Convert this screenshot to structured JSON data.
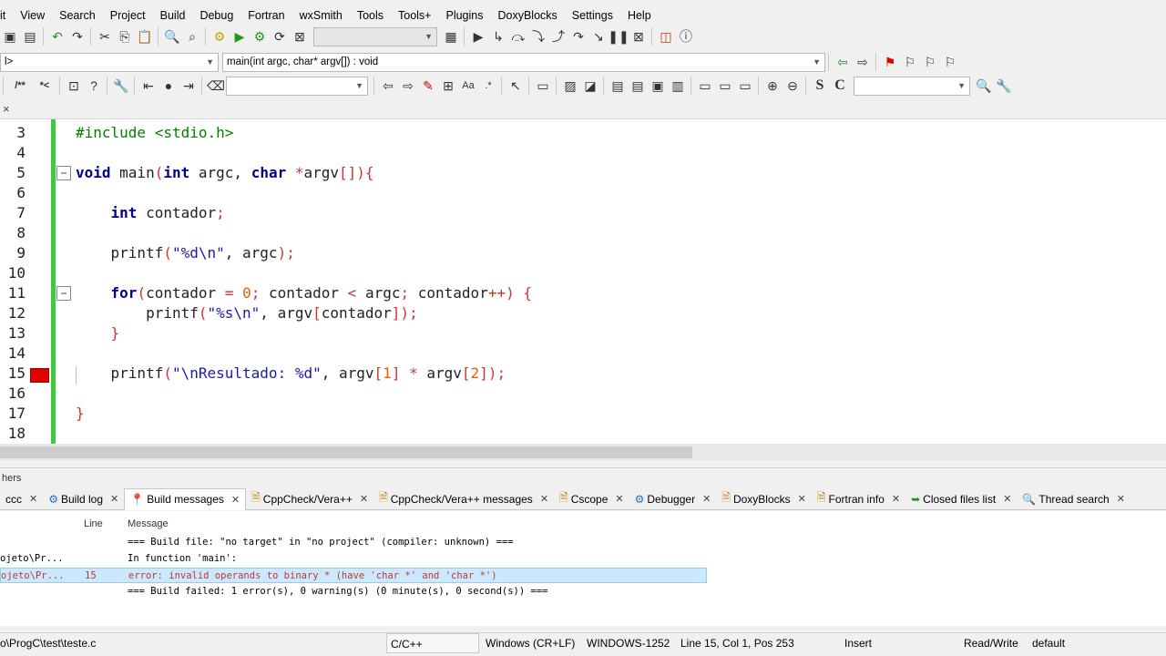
{
  "menu": [
    "it",
    "View",
    "Search",
    "Project",
    "Build",
    "Debug",
    "Fortran",
    "wxSmith",
    "Tools",
    "Tools+",
    "Plugins",
    "DoxyBlocks",
    "Settings",
    "Help"
  ],
  "toolbar2": {
    "scope_combo": "l>",
    "function_combo": "main(int argc, char* argv[]) : void"
  },
  "editor": {
    "close_glyph": "×",
    "lines": [
      {
        "n": "3",
        "html": "<span class=\"pp\">#include &lt;stdio.h&gt;</span>"
      },
      {
        "n": "4",
        "html": ""
      },
      {
        "n": "5",
        "html": "<span class=\"kw\">void</span> main<span class=\"op\">(</span><span class=\"kw\">int</span> argc, <span class=\"kw\">char</span> <span class=\"op\">*</span>argv<span class=\"op\">[]){</span>"
      },
      {
        "n": "6",
        "html": ""
      },
      {
        "n": "7",
        "html": "    <span class=\"kw\">int</span> contador<span class=\"op\">;</span>"
      },
      {
        "n": "8",
        "html": ""
      },
      {
        "n": "9",
        "html": "    printf<span class=\"op\">(</span><span class=\"str\">\"%d\\n\"</span>, argc<span class=\"op\">);</span>"
      },
      {
        "n": "10",
        "html": ""
      },
      {
        "n": "11",
        "html": "    <span class=\"kw\">for</span><span class=\"op\">(</span>contador <span class=\"op\">=</span> <span class=\"num\">0</span><span class=\"op\">;</span> contador <span class=\"op\">&lt;</span> argc<span class=\"op\">;</span> contador<span class=\"op\">++)</span> <span class=\"op\">{</span>"
      },
      {
        "n": "12",
        "html": "        printf<span class=\"op\">(</span><span class=\"str\">\"%s\\n\"</span>, argv<span class=\"op\">[</span>contador<span class=\"op\">]);</span>"
      },
      {
        "n": "13",
        "html": "    <span class=\"op\">}</span>"
      },
      {
        "n": "14",
        "html": ""
      },
      {
        "n": "15",
        "html": "    printf<span class=\"op\">(</span><span class=\"str\">\"\\nResultado: %d\"</span>, argv<span class=\"op\">[</span><span class=\"num\">1</span><span class=\"op\">]</span> <span class=\"op\">*</span> argv<span class=\"op\">[</span><span class=\"num\">2</span><span class=\"op\">]);</span>"
      },
      {
        "n": "16",
        "html": ""
      },
      {
        "n": "17",
        "html": "<span class=\"op\">}</span>"
      },
      {
        "n": "18",
        "html": ""
      }
    ]
  },
  "logs_title": "hers",
  "tabs": [
    {
      "label": "ccc",
      "icon": "",
      "active": false
    },
    {
      "label": "Build log",
      "icon": "gear-icon",
      "active": false
    },
    {
      "label": "Build messages",
      "icon": "pin-icon",
      "active": true
    },
    {
      "label": "CppCheck/Vera++",
      "icon": "doc-icon",
      "active": false
    },
    {
      "label": "CppCheck/Vera++ messages",
      "icon": "doc-icon",
      "active": false
    },
    {
      "label": "Cscope",
      "icon": "doc-icon",
      "active": false
    },
    {
      "label": "Debugger",
      "icon": "gear-icon",
      "active": false
    },
    {
      "label": "DoxyBlocks",
      "icon": "doc-icon",
      "active": false
    },
    {
      "label": "Fortran info",
      "icon": "doc-icon",
      "active": false
    },
    {
      "label": "Closed files list",
      "icon": "arrow-icon",
      "active": false
    },
    {
      "label": "Thread search",
      "icon": "search-icon",
      "active": false
    }
  ],
  "build_messages": {
    "col_line": "Line",
    "col_message": "Message",
    "rows": [
      {
        "file": "",
        "line": "",
        "message": "=== Build file: \"no target\" in \"no project\" (compiler: unknown) ===",
        "error": false
      },
      {
        "file": "ojeto\\Pr...",
        "line": "",
        "message": "In function 'main':",
        "error": false
      },
      {
        "file": "ojeto\\Pr...",
        "line": "15",
        "message": "error: invalid operands to binary * (have 'char *' and 'char *')",
        "error": true
      },
      {
        "file": "",
        "line": "",
        "message": "=== Build failed: 1 error(s), 0 warning(s) (0 minute(s), 0 second(s)) ===",
        "error": false
      }
    ]
  },
  "status": {
    "path": "o\\ProgC\\test\\teste.c",
    "lang": "C/C++",
    "eol": "Windows (CR+LF)",
    "encoding": "WINDOWS-1252",
    "position": "Line 15, Col 1, Pos 253",
    "mode": "Insert",
    "access": "Read/Write",
    "profile": "default"
  }
}
